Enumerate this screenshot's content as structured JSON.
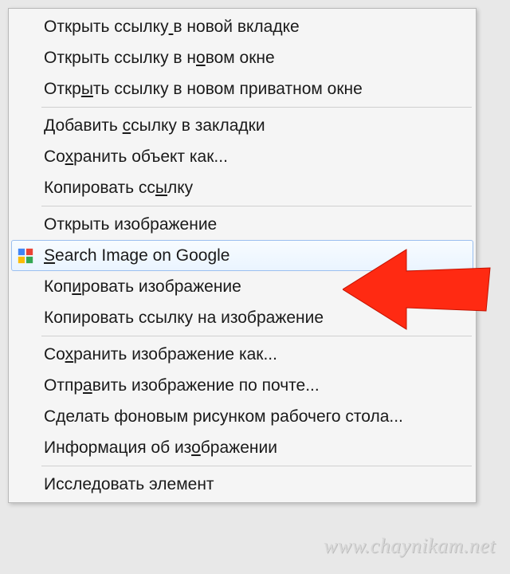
{
  "menu": {
    "groups": [
      [
        {
          "label": "Открыть ссылку в новой вкладке",
          "ul": 14,
          "icon": null
        },
        {
          "label": "Открыть ссылку в новом окне",
          "ul": 18,
          "icon": null
        },
        {
          "label": "Открыть ссылку в новом приватном окне",
          "ul": 4,
          "icon": null
        }
      ],
      [
        {
          "label": "Добавить ссылку в закладки",
          "ul": 9,
          "icon": null
        },
        {
          "label": "Сохранить объект как...",
          "ul": 2,
          "icon": null
        },
        {
          "label": "Копировать ссылку",
          "ul": 13,
          "icon": null
        }
      ],
      [
        {
          "label": "Открыть изображение",
          "ul": -1,
          "icon": null
        },
        {
          "label": "Search Image on Google",
          "ul": 0,
          "icon": "google",
          "highlighted": true
        },
        {
          "label": "Копировать изображение",
          "ul": 3,
          "icon": null
        },
        {
          "label": "Копировать ссылку на изображение",
          "ul": -1,
          "icon": null
        }
      ],
      [
        {
          "label": "Сохранить изображение как...",
          "ul": 2,
          "icon": null
        },
        {
          "label": "Отправить изображение по почте...",
          "ul": 4,
          "icon": null
        },
        {
          "label": "Сделать фоновым рисунком рабочего стола...",
          "ul": -1,
          "icon": null
        },
        {
          "label": "Информация об изображении",
          "ul": 16,
          "icon": null
        }
      ],
      [
        {
          "label": "Исследовать элемент",
          "ul": -1,
          "icon": null
        }
      ]
    ]
  },
  "arrow_color": "#ff2a12",
  "watermark": "www.chaynikam.net"
}
